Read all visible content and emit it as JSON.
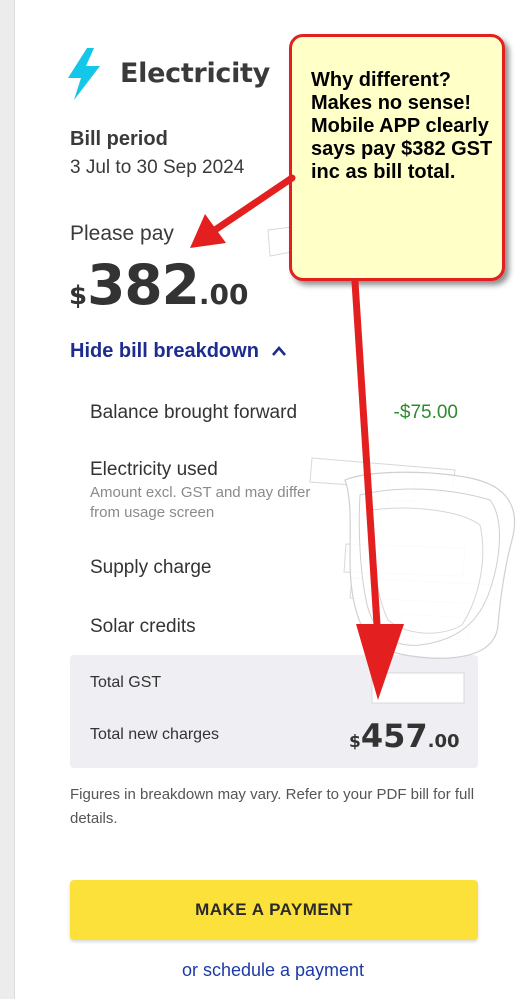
{
  "header": {
    "icon": "lightning-bolt-icon",
    "icon_color": "#12c7e8",
    "title": "Electricity"
  },
  "bill_period": {
    "label": "Bill period",
    "value": "3 Jul to 30 Sep 2024"
  },
  "payment_due": {
    "label": "Please pay",
    "currency": "$",
    "whole": "382",
    "cents": ".00"
  },
  "breakdown": {
    "toggle_label": "Hide bill breakdown",
    "toggle_icon": "chevron-up-icon",
    "balance_label": "Balance brought forward",
    "balance_value": "-$75.00",
    "balance_color": "#2e8b2e",
    "electricity_label": "Electricity used",
    "electricity_sub": "Amount excl. GST and may differ from usage screen",
    "supply_label": "Supply charge",
    "solar_label": "Solar credits",
    "gst_label": "Total GST",
    "total_label": "Total new charges",
    "total_currency": "$",
    "total_whole": "457",
    "total_cents": ".00",
    "note": "Figures in breakdown may vary. Refer to your PDF bill for full details."
  },
  "actions": {
    "pay_button": "MAKE A PAYMENT",
    "pay_button_color": "#fde13b",
    "schedule_link": "or schedule a payment"
  },
  "annotation": {
    "text": "Why different? Makes no sense!  Mobile APP clearly says pay $382 GST inc as bill total.",
    "border_color": "#e3201f",
    "fill_color": "#ffffc8"
  }
}
